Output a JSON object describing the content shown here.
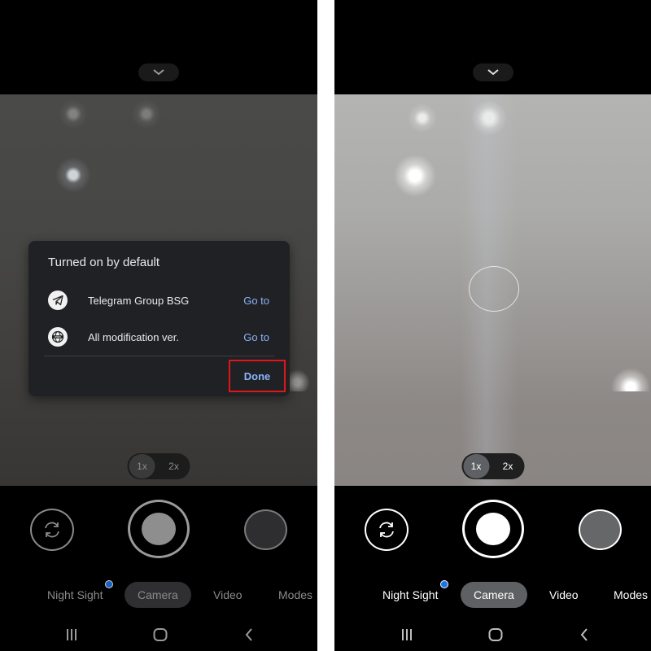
{
  "screens": [
    {
      "id": "left",
      "viewfinder": {
        "zoom_options": [
          "1x",
          "2x"
        ],
        "selected_zoom": "1x"
      },
      "dialog": {
        "title": "Turned on by default",
        "items": [
          {
            "icon": "telegram-icon",
            "label": "Telegram Group BSG",
            "action": "Go to"
          },
          {
            "icon": "globe-www-icon",
            "label": "All modification ver.",
            "action": "Go to"
          }
        ],
        "done_label": "Done",
        "highlight_color": "#e0161c"
      },
      "modes": {
        "items": [
          "Night Sight",
          "Camera",
          "Video",
          "Modes"
        ],
        "active": "Camera",
        "badge_on": "Night Sight"
      },
      "nav": [
        "recent-apps-icon",
        "home-icon",
        "back-icon"
      ]
    },
    {
      "id": "right",
      "viewfinder": {
        "zoom_options": [
          "1x",
          "2x"
        ],
        "selected_zoom": "1x",
        "focus_indicator": true
      },
      "modes": {
        "items": [
          "Night Sight",
          "Camera",
          "Video",
          "Modes"
        ],
        "active": "Camera",
        "badge_on": "Night Sight"
      },
      "nav": [
        "recent-apps-icon",
        "home-icon",
        "back-icon"
      ]
    }
  ],
  "colors": {
    "link_blue": "#8ab4f8",
    "badge_blue": "#1a73e8",
    "dialog_bg": "#202124"
  }
}
